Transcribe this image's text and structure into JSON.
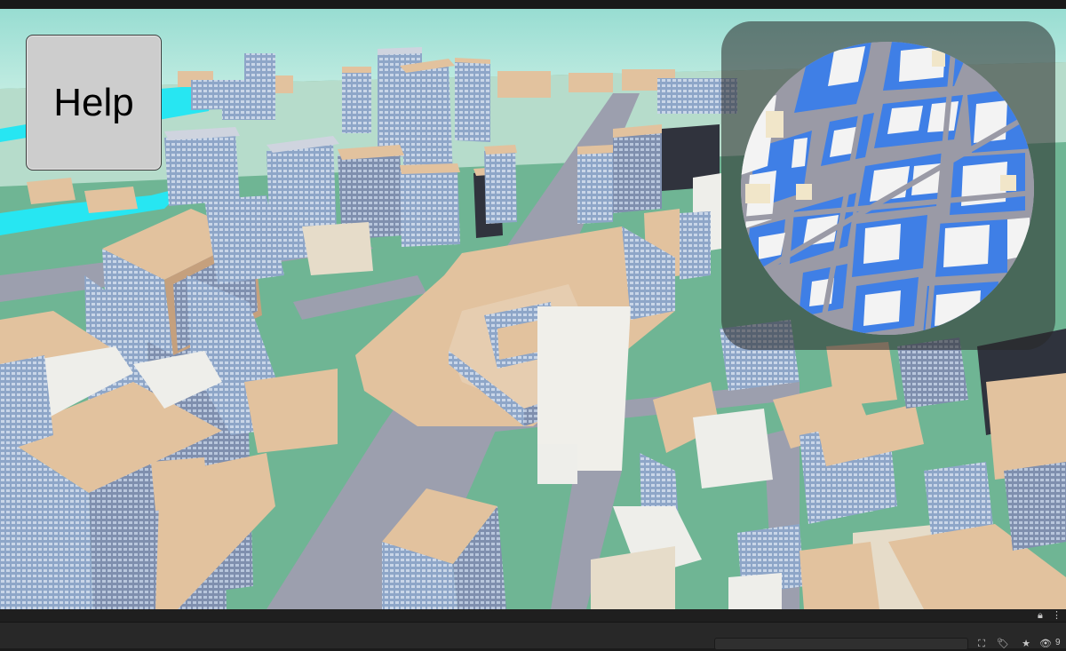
{
  "help_button": {
    "label": "Help"
  },
  "toolbar": {
    "search_placeholder": "",
    "hidden_count": "9",
    "icons": [
      "lock-icon",
      "kebab-menu-icon",
      "search-icon",
      "scene-filter-icon",
      "tag-icon",
      "favorite-star-icon",
      "visibility-eye-icon"
    ]
  },
  "colors": {
    "sky": "#bfe9dc",
    "ground": "#6fb594",
    "water": "#27e6f2",
    "road": "#9c9fae",
    "building_roof": "#e2c29e",
    "building_facade": "#8da3c4",
    "minimap_building": "#f3f3f3",
    "minimap_block": "#3f7fe6",
    "minimap_road": "#9a9aa6"
  }
}
